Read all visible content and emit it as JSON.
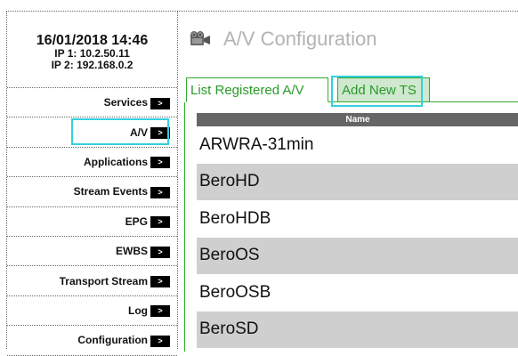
{
  "status": {
    "datetime": "16/01/2018 14:46",
    "ip1": "IP 1: 10.2.50.11",
    "ip2": "IP 2: 192.168.0.2"
  },
  "sidebar": {
    "arrow_glyph": ">",
    "items": [
      {
        "label": "Services"
      },
      {
        "label": "A/V"
      },
      {
        "label": "Applications"
      },
      {
        "label": "Stream Events"
      },
      {
        "label": "EPG"
      },
      {
        "label": "EWBS"
      },
      {
        "label": "Transport Stream"
      },
      {
        "label": "Log"
      },
      {
        "label": "Configuration"
      }
    ],
    "active_index": 1
  },
  "main": {
    "icon": "film-reel-icon",
    "title": "A/V Configuration",
    "tabs": [
      {
        "label": "List Registered A/V"
      },
      {
        "label": "Add New TS"
      }
    ]
  },
  "table": {
    "header": "Name",
    "rows": [
      "ARWRA-31min",
      "BeroHD",
      "BeroHDB",
      "BeroOS",
      "BeroOSB",
      "BeroSD"
    ]
  },
  "colors": {
    "accent_green": "#2faa2f",
    "tab_active_bg": "#cfe8cf",
    "highlight_cyan": "#35d0e0",
    "table_header_bg": "#666666",
    "row_alt_bg": "#cfcfcf"
  }
}
